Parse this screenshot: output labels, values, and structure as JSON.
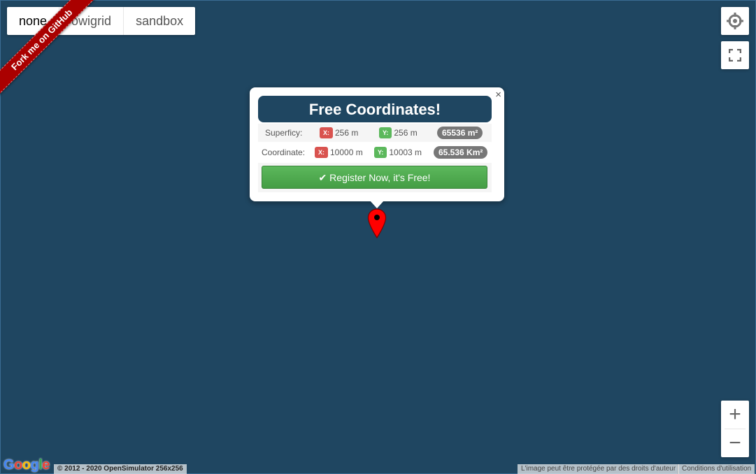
{
  "map_types": [
    "none",
    "owigrid",
    "sandbox"
  ],
  "ribbon": "Fork me on GitHub",
  "controls": {
    "locate_icon": "crosshair-icon",
    "fullscreen_icon": "fullscreen-icon",
    "zoom_in": "+",
    "zoom_out": "−"
  },
  "info_window": {
    "close": "×",
    "title": "Free Coordinates!",
    "superficy": {
      "label": "Superficy:",
      "x_tag": "X:",
      "x_value": "256 m",
      "y_tag": "Y:",
      "y_value": "256 m",
      "total": "65536 m²"
    },
    "coordinate": {
      "label": "Coordinate:",
      "x_tag": "X:",
      "x_value": "10000 m",
      "y_tag": "Y:",
      "y_value": "10003 m",
      "total": "65.536 Km²"
    },
    "register_icon": "✔",
    "register_label": "Register Now, it's Free!"
  },
  "footer": {
    "google_logo": "Google",
    "copyright": "© 2012 - 2020 OpenSimulator 256x256",
    "image_notice": "L'image peut être protégée par des droits d'auteur",
    "terms": "Conditions d'utilisation"
  },
  "colors": {
    "map_background": "#1f4661",
    "title_bar": "#1f4661",
    "ribbon": "#aa0000",
    "register_button": "#5cb85c",
    "marker": "#ff0000"
  }
}
